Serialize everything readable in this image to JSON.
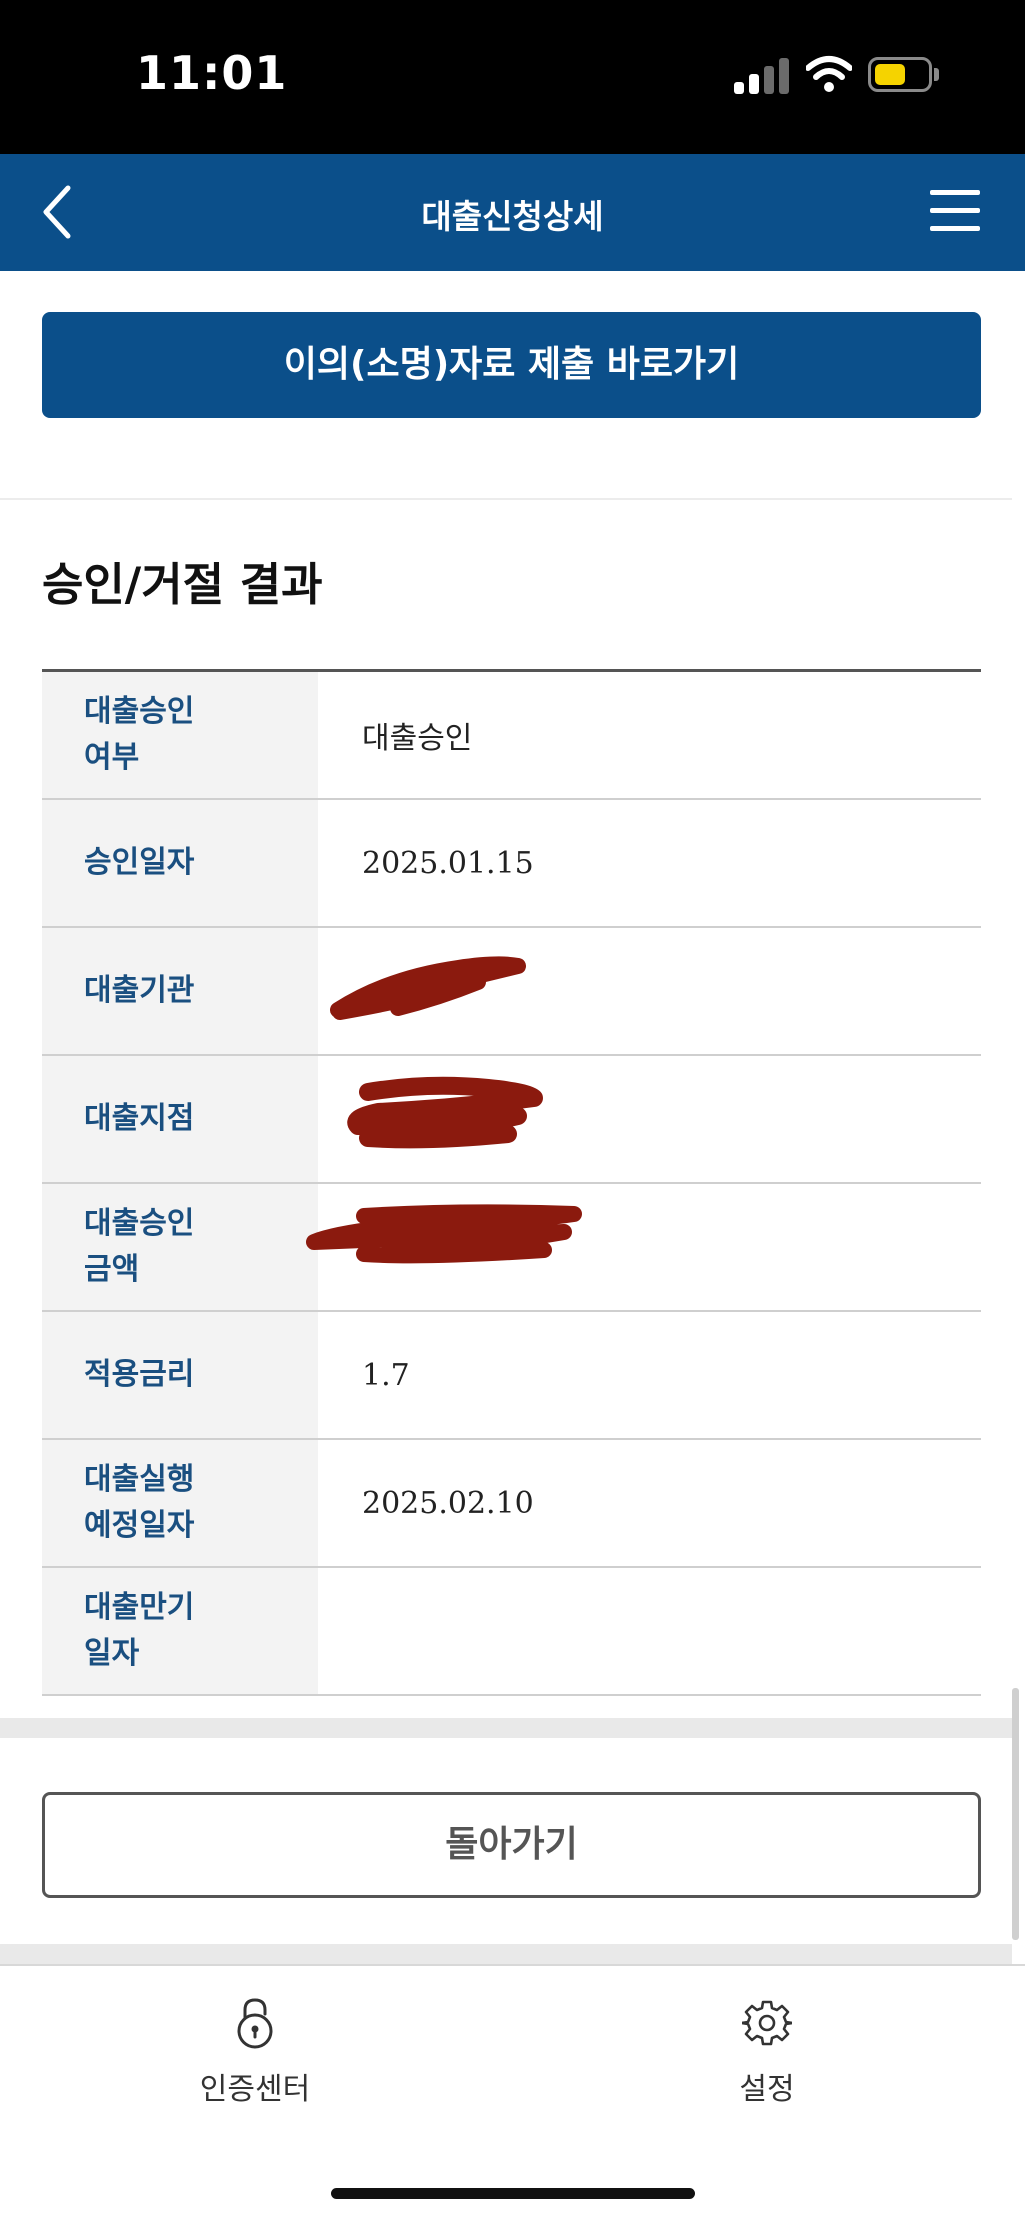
{
  "status_bar": {
    "time": "11:01"
  },
  "header": {
    "title": "대출신청상세"
  },
  "objection_button": {
    "label": "이의(소명)자료 제출  바로가기"
  },
  "section": {
    "title": "승인/거절 결과"
  },
  "result_table": {
    "rows": [
      {
        "label": "대출승인\n여부",
        "value": "대출승인"
      },
      {
        "label": "승인일자",
        "value": "2025.01.15"
      },
      {
        "label": "대출기관",
        "value": ""
      },
      {
        "label": "대출지점",
        "value": ""
      },
      {
        "label": "대출승인\n금액",
        "value": ""
      },
      {
        "label": "적용금리",
        "value": "1.7"
      },
      {
        "label": "대출실행\n예정일자",
        "value": "2025.02.10"
      },
      {
        "label": "대출만기\n일자",
        "value": ""
      }
    ]
  },
  "back_button": {
    "label": "돌아가기"
  },
  "tabbar": {
    "items": [
      {
        "label": "인증센터",
        "icon": "lock-icon"
      },
      {
        "label": "설정",
        "icon": "gear-icon"
      }
    ]
  },
  "colors": {
    "primary": "#0b4f8a",
    "label_text": "#1a4f80",
    "redaction": "#8b1a0e"
  }
}
